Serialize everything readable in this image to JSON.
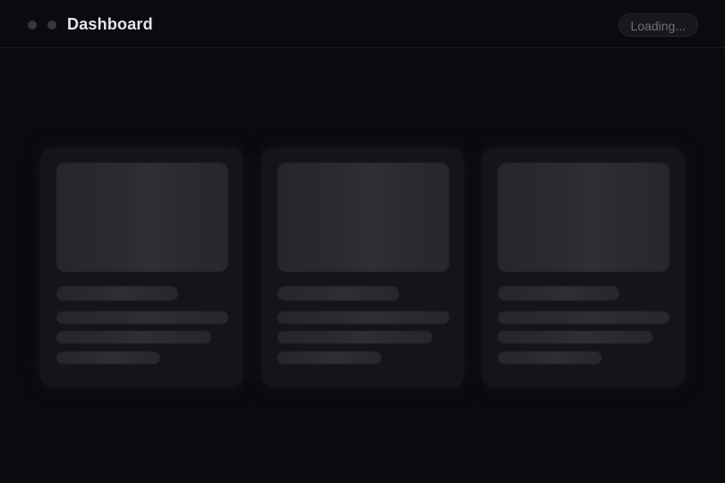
{
  "window": {
    "title": "Dashboard",
    "status_label": "Loading..."
  },
  "cards": [
    {
      "state": "loading-skeleton"
    },
    {
      "state": "loading-skeleton"
    },
    {
      "state": "loading-skeleton"
    }
  ],
  "colors": {
    "background": "#0b0b0f",
    "card": "#151519",
    "skeleton": "#2a2a2f",
    "title_text": "#e6e6ea",
    "status_text": "#6e6e76"
  }
}
